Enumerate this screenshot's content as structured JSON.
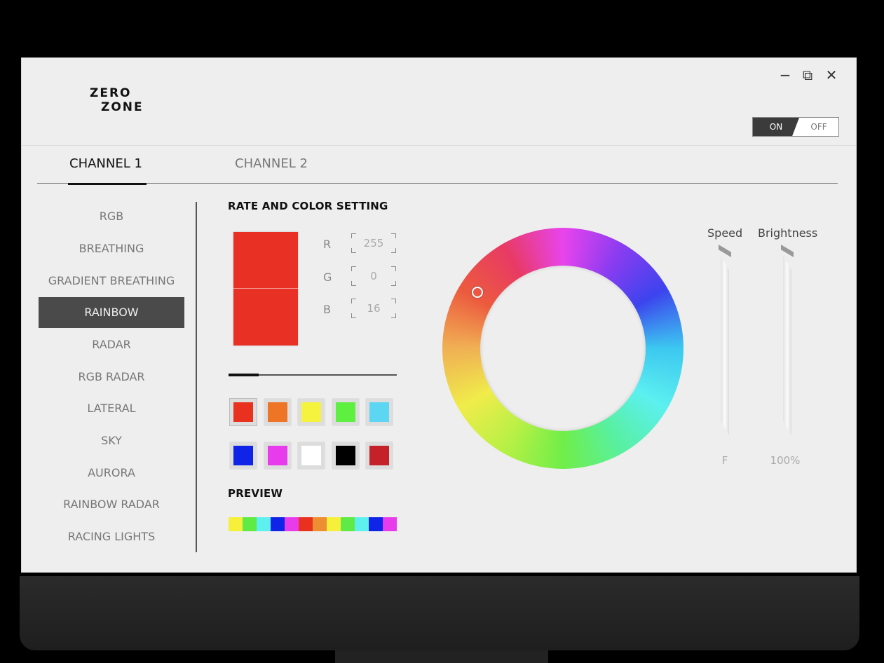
{
  "app": {
    "logo_line1": "ZERO",
    "logo_line2": "ZONE",
    "power": {
      "on_label": "ON",
      "off_label": "OFF",
      "state": "ON"
    }
  },
  "window_controls": {
    "minimize": "−",
    "restore": "⧉",
    "close": "✕"
  },
  "tabs": [
    {
      "label": "CHANNEL 1",
      "active": true
    },
    {
      "label": "CHANNEL 2",
      "active": false
    }
  ],
  "modes": [
    {
      "label": "RGB",
      "active": false
    },
    {
      "label": "BREATHING",
      "active": false
    },
    {
      "label": "GRADIENT BREATHING",
      "active": false
    },
    {
      "label": "RAINBOW",
      "active": true
    },
    {
      "label": "RADAR",
      "active": false
    },
    {
      "label": "RGB RADAR",
      "active": false
    },
    {
      "label": "LATERAL",
      "active": false
    },
    {
      "label": "SKY",
      "active": false
    },
    {
      "label": "AURORA",
      "active": false
    },
    {
      "label": "RAINBOW RADAR",
      "active": false
    },
    {
      "label": "RACING LIGHTS",
      "active": false
    }
  ],
  "color_setting": {
    "title": "RATE AND COLOR SETTING",
    "current_color": "#e83025",
    "r_label": "R",
    "r_value": "255",
    "g_label": "G",
    "g_value": "0",
    "b_label": "B",
    "b_value": "16",
    "rate_fraction": 0.18
  },
  "presets": [
    "#e8321f",
    "#ee7426",
    "#f5f33e",
    "#5ef040",
    "#5cd6f2",
    "#1024e8",
    "#e83cec",
    "#ffffff",
    "#000000",
    "#c42228"
  ],
  "preview": {
    "title": "PREVIEW",
    "colors": [
      "#f6f03a",
      "#60ea45",
      "#5ef0ef",
      "#1024e8",
      "#e83cec",
      "#e8321f",
      "#ee8e32",
      "#f6f03a",
      "#60ea45",
      "#5ef0ef",
      "#1024e8",
      "#e83cec"
    ]
  },
  "sliders": {
    "speed_label": "Speed",
    "speed_value": "F",
    "brightness_label": "Brightness",
    "brightness_value": "100%"
  }
}
